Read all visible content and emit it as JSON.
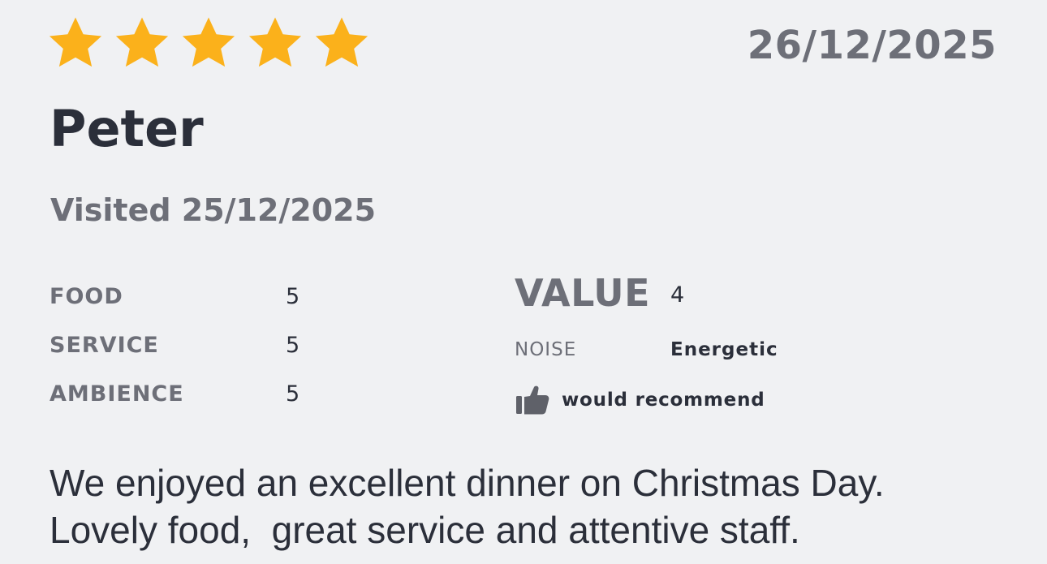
{
  "review": {
    "stars": {
      "rating": 5,
      "max": 5,
      "icon": "star-icon",
      "color": "#fbb11b"
    },
    "date": "26/12/2025",
    "reviewer": "Peter",
    "visited": "Visited 25/12/2025",
    "ratings": {
      "food": {
        "label": "FOOD",
        "value": "5"
      },
      "service": {
        "label": "SERVICE",
        "value": "5"
      },
      "ambience": {
        "label": "AMBIENCE",
        "value": "5"
      },
      "value": {
        "label": "VALUE",
        "value": "4"
      },
      "noise": {
        "label": "NOISE",
        "value": "Energetic"
      }
    },
    "recommend": {
      "icon": "thumbs-up-icon",
      "text": "would recommend"
    },
    "text": {
      "line1": "We enjoyed an excellent dinner on Christmas Day.",
      "line2": "Lovely food,  great service and attentive staff."
    }
  }
}
